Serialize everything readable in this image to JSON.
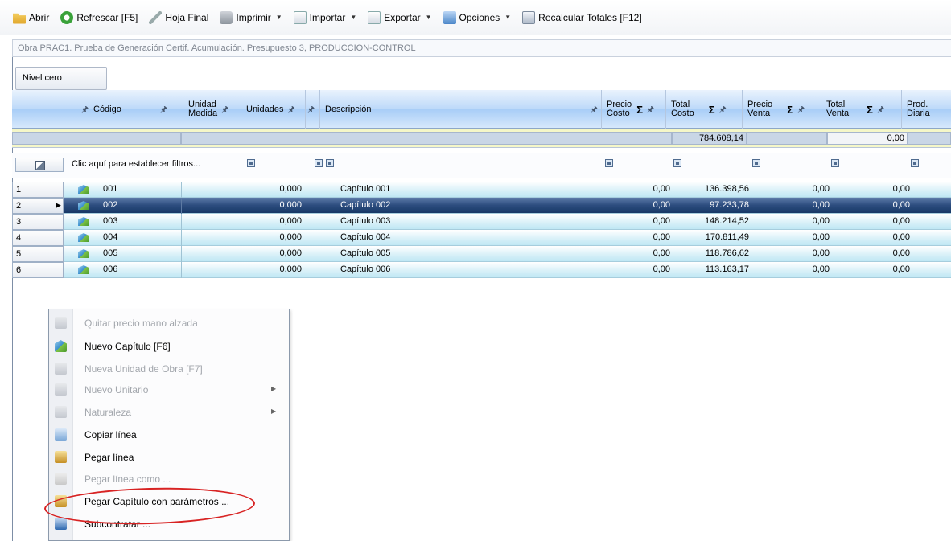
{
  "toolbar": {
    "items": [
      {
        "label": "Abrir",
        "icon": "folder-icon",
        "dropdown": false
      },
      {
        "label": "Refrescar [F5]",
        "icon": "refresh-icon",
        "dropdown": false
      },
      {
        "label": "Hoja Final",
        "icon": "pen-icon",
        "dropdown": false
      },
      {
        "label": "Imprimir",
        "icon": "printer-icon",
        "dropdown": true
      },
      {
        "label": "Importar",
        "icon": "import-icon",
        "dropdown": true
      },
      {
        "label": "Exportar",
        "icon": "export-icon",
        "dropdown": true
      },
      {
        "label": "Opciones",
        "icon": "options-icon",
        "dropdown": true
      },
      {
        "label": "Recalcular Totales [F12]",
        "icon": "calculator-icon",
        "dropdown": false
      }
    ]
  },
  "breadcrumb": "Obra PRAC1. Prueba de Generación Certif. Acumulación. Presupuesto 3, PRODUCCION-CONTROL",
  "level_button": "Nivel cero",
  "grid": {
    "columns": [
      {
        "label": "Código"
      },
      {
        "label1": "Unidad",
        "label2": "Medida"
      },
      {
        "label": "Unidades"
      },
      {
        "label": "Descripción"
      },
      {
        "label1": "Precio",
        "label2": "Costo"
      },
      {
        "label1": "Total",
        "label2": "Costo"
      },
      {
        "label1": "Precio",
        "label2": "Venta"
      },
      {
        "label1": "Total",
        "label2": "Venta"
      },
      {
        "label1": "Prod.",
        "label2": "Diaria"
      }
    ],
    "totals": {
      "total_costo": "784.608,14",
      "total_venta": "0,00"
    },
    "filter_text": "Clic aquí para establecer filtros...",
    "rows": [
      {
        "num": "1",
        "codigo": "001",
        "unidades": "0,000",
        "descripcion": "Capítulo 001",
        "precio_costo": "0,00",
        "total_costo": "136.398,56",
        "precio_venta": "0,00",
        "total_venta": "0,00"
      },
      {
        "num": "2",
        "codigo": "002",
        "unidades": "0,000",
        "descripcion": "Capítulo 002",
        "precio_costo": "0,00",
        "total_costo": "97.233,78",
        "precio_venta": "0,00",
        "total_venta": "0,00"
      },
      {
        "num": "3",
        "codigo": "003",
        "unidades": "0,000",
        "descripcion": "Capítulo 003",
        "precio_costo": "0,00",
        "total_costo": "148.214,52",
        "precio_venta": "0,00",
        "total_venta": "0,00"
      },
      {
        "num": "4",
        "codigo": "004",
        "unidades": "0,000",
        "descripcion": "Capítulo 004",
        "precio_costo": "0,00",
        "total_costo": "170.811,49",
        "precio_venta": "0,00",
        "total_venta": "0,00"
      },
      {
        "num": "5",
        "codigo": "005",
        "unidades": "0,000",
        "descripcion": "Capítulo 005",
        "precio_costo": "0,00",
        "total_costo": "118.786,62",
        "precio_venta": "0,00",
        "total_venta": "0,00"
      },
      {
        "num": "6",
        "codigo": "006",
        "unidades": "0,000",
        "descripcion": "Capítulo 006",
        "precio_costo": "0,00",
        "total_costo": "113.163,17",
        "precio_venta": "0,00",
        "total_venta": "0,00"
      }
    ]
  },
  "context_menu": {
    "items": [
      {
        "label": "Quitar precio mano alzada",
        "enabled": false,
        "submenu": false,
        "icon": "remove-price-icon"
      },
      {
        "label": "Nuevo Capítulo [F6]",
        "enabled": true,
        "submenu": false,
        "icon": "chapter-icon"
      },
      {
        "label": "Nueva Unidad de Obra [F7]",
        "enabled": false,
        "submenu": false,
        "icon": "work-unit-icon"
      },
      {
        "label": "Nuevo Unitario",
        "enabled": false,
        "submenu": true,
        "icon": "unit-icon"
      },
      {
        "label": "Naturaleza",
        "enabled": false,
        "submenu": true,
        "icon": "nature-icon"
      },
      {
        "label": "Copiar línea",
        "enabled": true,
        "submenu": false,
        "icon": "copy-icon"
      },
      {
        "label": "Pegar línea",
        "enabled": true,
        "submenu": false,
        "icon": "paste-icon"
      },
      {
        "label": "Pegar línea como ...",
        "enabled": false,
        "submenu": false,
        "icon": "paste-as-icon"
      },
      {
        "label": "Pegar Capítulo con parámetros ...",
        "enabled": true,
        "submenu": false,
        "icon": "paste-chapter-icon"
      },
      {
        "label": "Subcontratar ...",
        "enabled": true,
        "submenu": false,
        "icon": "subcontract-icon"
      }
    ]
  },
  "colors": {
    "selected_row": "#2c4c7e",
    "row_tint": "#bfe7f4",
    "annotation": "#d82323"
  }
}
